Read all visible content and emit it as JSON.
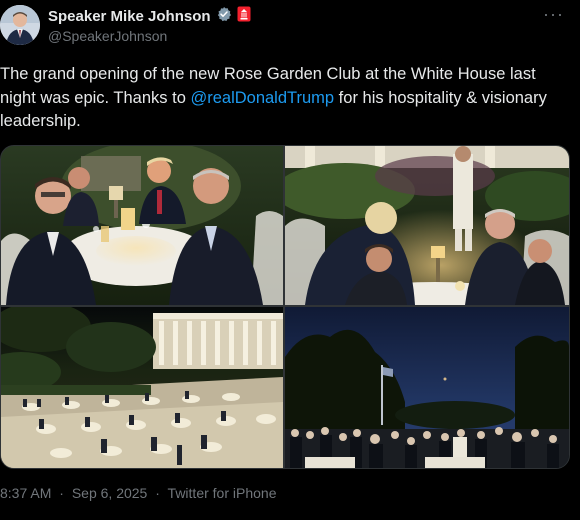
{
  "author": {
    "display_name": "Speaker Mike Johnson",
    "handle": "@SpeakerJohnson"
  },
  "more_label": "···",
  "tweet": {
    "text_before": "The grand opening of the new Rose Garden Club at the White House last night was epic. Thanks to ",
    "mention": "@realDonaldTrump",
    "text_after": " for his hospitality & visionary leadership."
  },
  "meta": {
    "time": "8:37 AM",
    "separator": "·",
    "date": "Sep 6, 2025",
    "source": "Twitter for iPhone"
  },
  "colors": {
    "background": "#000000",
    "text": "#e7e9ea",
    "secondary": "#71767b",
    "link": "#1d9bf0",
    "verified_badge": "#829aab",
    "government_badge": "#f4212e"
  },
  "icons": [
    "verified-badge-icon",
    "government-badge-icon",
    "more-options-icon"
  ],
  "media": {
    "photos": [
      "photo-dinner-table",
      "photo-toast-guests",
      "photo-garden-overview",
      "photo-dusk-gathering"
    ]
  }
}
